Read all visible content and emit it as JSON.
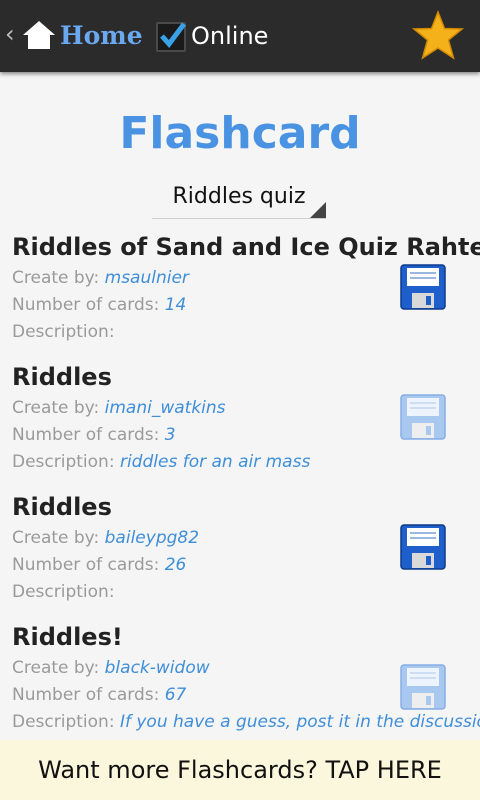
{
  "header": {
    "home_label": "Home",
    "online_label": "Online",
    "online_checked": true,
    "colors": {
      "bar": "#2b2b2b",
      "home_text": "#6aa8f0",
      "star": "#f5b11a"
    }
  },
  "page": {
    "title": "Flashcard",
    "category_selected": "Riddles quiz",
    "title_color": "#4a93e2"
  },
  "labels": {
    "create_by": "Create by:",
    "number_of_cards": "Number of cards:",
    "description": "Description:"
  },
  "flashcards": [
    {
      "title": "Riddles of Sand and Ice Quiz Rahter",
      "creator": "msaulnier",
      "cards": "14",
      "description": "",
      "save_icon": "save-icon-active"
    },
    {
      "title": "Riddles",
      "creator": "imani_watkins",
      "cards": "3",
      "description": "riddles for an air mass",
      "save_icon": "save-icon-faded"
    },
    {
      "title": "Riddles",
      "creator": "baileypg82",
      "cards": "26",
      "description": "",
      "save_icon": "save-icon-active"
    },
    {
      "title": "Riddles!",
      "creator": "black-widow",
      "cards": "67",
      "description": "If you have a guess, post it in the discussion",
      "save_icon": "save-icon-faded"
    }
  ],
  "banner": {
    "text": "Want more Flashcards? TAP HERE"
  }
}
